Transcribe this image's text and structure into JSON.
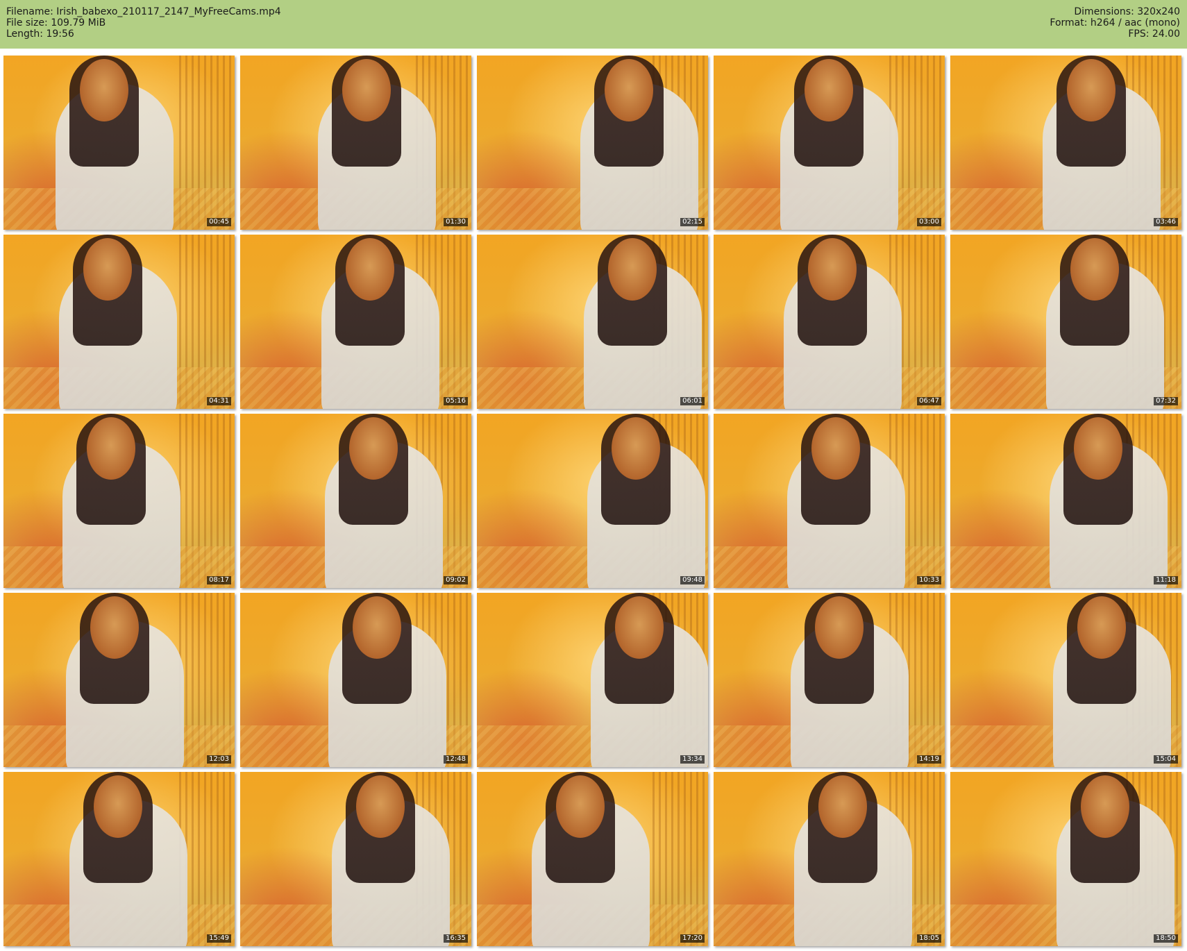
{
  "header": {
    "filename_line": "Filename: Irish_babexo_210117_2147_MyFreeCams.mp4",
    "filesize_line": "File size: 109.79 MiB",
    "length_line": "Length: 19:56",
    "dimensions_line": "Dimensions: 320x240",
    "format_line": "Format: h264 / aac (mono)",
    "fps_line": "FPS: 24.00"
  },
  "colors": {
    "header_bg": "#b2cf84",
    "page_bg": "#ffffff"
  },
  "thumbnails": [
    {
      "timestamp": "00:45"
    },
    {
      "timestamp": "01:30"
    },
    {
      "timestamp": "02:15"
    },
    {
      "timestamp": "03:00"
    },
    {
      "timestamp": "03:46"
    },
    {
      "timestamp": "04:31"
    },
    {
      "timestamp": "05:16"
    },
    {
      "timestamp": "06:01"
    },
    {
      "timestamp": "06:47"
    },
    {
      "timestamp": "07:32"
    },
    {
      "timestamp": "08:17"
    },
    {
      "timestamp": "09:02"
    },
    {
      "timestamp": "09:48"
    },
    {
      "timestamp": "10:33"
    },
    {
      "timestamp": "11:18"
    },
    {
      "timestamp": "12:03"
    },
    {
      "timestamp": "12:48"
    },
    {
      "timestamp": "13:34"
    },
    {
      "timestamp": "14:19"
    },
    {
      "timestamp": "15:04"
    },
    {
      "timestamp": "15:49"
    },
    {
      "timestamp": "16:35"
    },
    {
      "timestamp": "17:20"
    },
    {
      "timestamp": "18:05"
    },
    {
      "timestamp": "18:50"
    }
  ]
}
